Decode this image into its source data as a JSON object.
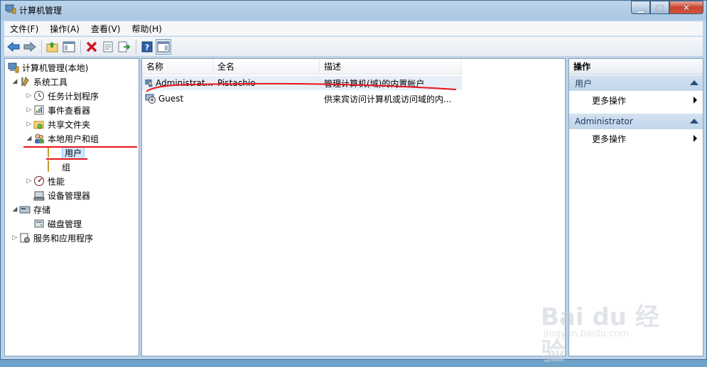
{
  "window": {
    "title": "计算机管理"
  },
  "menu": [
    "文件(F)",
    "操作(A)",
    "查看(V)",
    "帮助(H)"
  ],
  "toolbar_icons": [
    "back-icon",
    "forward-icon",
    "up-folder-icon",
    "show-hide-tree-icon",
    "delete-icon",
    "properties-icon",
    "export-icon",
    "help-icon",
    "show-hide-action-pane-icon"
  ],
  "tree": {
    "root": "计算机管理(本地)",
    "system_tools": "系统工具",
    "task_scheduler": "任务计划程序",
    "event_viewer": "事件查看器",
    "shared_folders": "共享文件夹",
    "local_users_groups": "本地用户和组",
    "users": "用户",
    "groups": "组",
    "performance": "性能",
    "device_manager": "设备管理器",
    "storage": "存储",
    "disk_management": "磁盘管理",
    "services_apps": "服务和应用程序"
  },
  "list": {
    "columns": [
      "名称",
      "全名",
      "描述"
    ],
    "rows": [
      {
        "name": "Administrat...",
        "fullname": "Pistachio",
        "desc": "管理计算机(域)的内置帐户"
      },
      {
        "name": "Guest",
        "fullname": "",
        "desc": "供来宾访问计算机或访问域的内..."
      }
    ]
  },
  "actions": {
    "title": "操作",
    "section1": "用户",
    "section1_more": "更多操作",
    "section2": "Administrator",
    "section2_more": "更多操作"
  },
  "watermark": {
    "brand": "Bai du 经验",
    "url": "jingyan.baidu.com"
  },
  "colors": {
    "annotation_red": "#e8141b",
    "selected_bg": "#cde8ff"
  }
}
